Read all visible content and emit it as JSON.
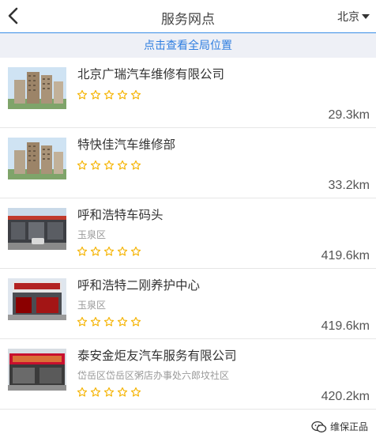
{
  "header": {
    "title": "服务网点",
    "city": "北京",
    "back_icon": "back-chevron-icon",
    "city_dropdown_icon": "caret-down-icon"
  },
  "banner": {
    "label": "点击查看全局位置"
  },
  "items": [
    {
      "name": "北京广瑞汽车维修有限公司",
      "area": "",
      "distance": "29.3km",
      "rating": 5,
      "thumb": "apartment-building-photo"
    },
    {
      "name": "特快佳汽车维修部",
      "area": "",
      "distance": "33.2km",
      "rating": 5,
      "thumb": "apartment-building-photo"
    },
    {
      "name": "呼和浩特车码头",
      "area": "玉泉区",
      "distance": "419.6km",
      "rating": 5,
      "thumb": "garage-storefront-photo"
    },
    {
      "name": "呼和浩特二刚养护中心",
      "area": "玉泉区",
      "distance": "419.6km",
      "rating": 5,
      "thumb": "red-storefront-photo"
    },
    {
      "name": "泰安金炬友汽车服务有限公司",
      "area": "岱岳区岱岳区粥店办事处六郎坟社区",
      "distance": "420.2km",
      "rating": 5,
      "thumb": "signboard-storefront-photo"
    }
  ],
  "watermark": {
    "text": "维保正品",
    "icon": "wechat-icon"
  },
  "colors": {
    "accent": "#2f7ee0",
    "star": "#f5b301",
    "banner_bg": "#eef0f6"
  }
}
